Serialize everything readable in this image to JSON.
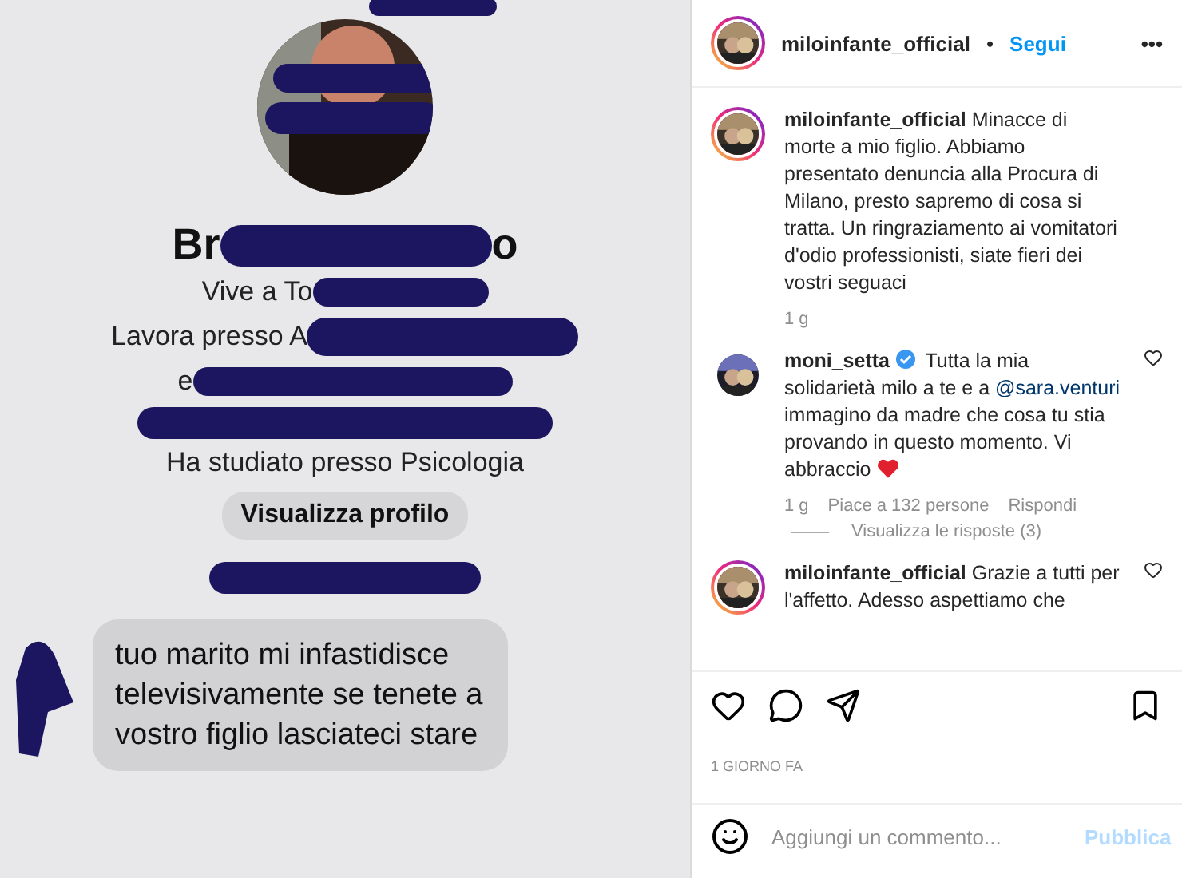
{
  "screenshot": {
    "name_start": "Br",
    "name_end": "o",
    "lines": [
      {
        "kind": "cut",
        "text": "Vive a To"
      },
      {
        "kind": "cut",
        "text": "Lavora presso A"
      },
      {
        "kind": "cut",
        "text": "e"
      },
      {
        "kind": "scribble"
      },
      {
        "kind": "plain",
        "text": "Ha studiato presso Psicologia"
      }
    ],
    "profile_button": "Visualizza profilo",
    "message": "tuo marito mi infastidisce televisivamente se tenete a vostro figlio lasciateci stare"
  },
  "post": {
    "author": "miloinfante_official",
    "separator": "•",
    "follow": "Segui",
    "more": "•••",
    "caption": {
      "author": "miloinfante_official",
      "text": "Minacce di morte a mio figlio. Abbiamo presentato denuncia alla Procura di Milano, presto sapremo di cosa si tratta. Un ringraziamento ai vomitatori d'odio professionisti, siate fieri dei vostri seguaci",
      "age": "1 g"
    },
    "comments": [
      {
        "author": "moni_setta",
        "verified": true,
        "text_before": "Tutta la mia solidarietà milo a te e a",
        "mention": "@sara.venturi",
        "text_after": "immagino da madre che cosa tu stia provando in questo momento. Vi abbraccio",
        "heart_emoji": true,
        "age": "1 g",
        "likes": "Piace a 132 persone",
        "reply": "Rispondi",
        "replies": "Visualizza le risposte (3)",
        "ring": false
      },
      {
        "author": "miloinfante_official",
        "verified": false,
        "text_before": "Grazie a tutti per l'affetto. Adesso aspettiamo che",
        "ring": true
      }
    ],
    "time": "1 GIORNO FA",
    "comment_field": {
      "placeholder": "Aggiungi un commento..."
    },
    "publish": "Pubblica"
  }
}
